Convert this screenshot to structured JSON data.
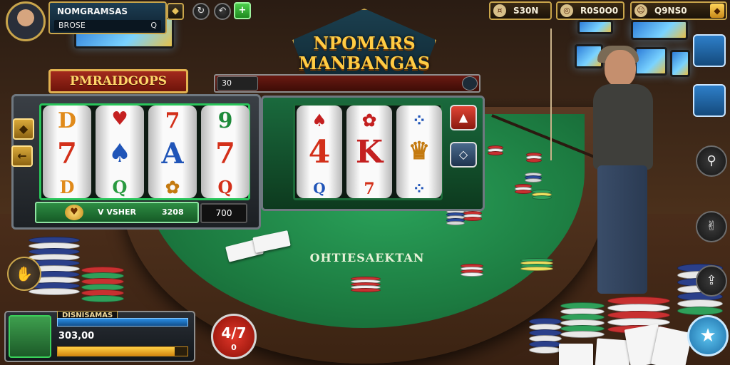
{
  "player": {
    "name": "NOMGRAMSAS",
    "sub_label": "BROSE",
    "sub_value": "Q"
  },
  "toolbar": {
    "diamond_icon": "diamond-icon",
    "refresh_icon": "refresh-icon",
    "back_icon": "back-icon",
    "plus_icon": "plus-icon"
  },
  "logo": {
    "line1": "NPOMARS",
    "line2": "MANBANGAS"
  },
  "currencies": [
    {
      "icon": "coin-icon",
      "value": "S30N"
    },
    {
      "icon": "chip-icon",
      "value": "R0S0O0"
    },
    {
      "icon": "avatar-icon",
      "value": "Q9NS0"
    }
  ],
  "slot_left": {
    "header": "PMRAIDGOPS",
    "reels": [
      [
        "D",
        "7",
        "D"
      ],
      [
        "♥",
        "♠",
        "Q"
      ],
      [
        "7",
        "A",
        "✿"
      ],
      [
        "9",
        "7",
        "Q"
      ]
    ],
    "bar_label": "V  VSHER",
    "bar_value": "3208",
    "total": "700"
  },
  "slot_right": {
    "header_value": "30",
    "reels": [
      [
        "♠",
        "4",
        "Q"
      ],
      [
        "✿",
        "K",
        "7"
      ],
      [
        "⁘",
        "♛",
        "⁘"
      ]
    ]
  },
  "table": {
    "text": "OHTIESAEKTAN"
  },
  "bottom_left": {
    "title": "DISNISAMAS",
    "value": "303,00",
    "progress": 0.9
  },
  "red_disc": {
    "line1": "4/7",
    "line2": "0"
  },
  "colors": {
    "gold": "#c9a54b",
    "felt": "#1c7a40",
    "accent_green": "#29c55a",
    "red": "#a32a1d"
  }
}
